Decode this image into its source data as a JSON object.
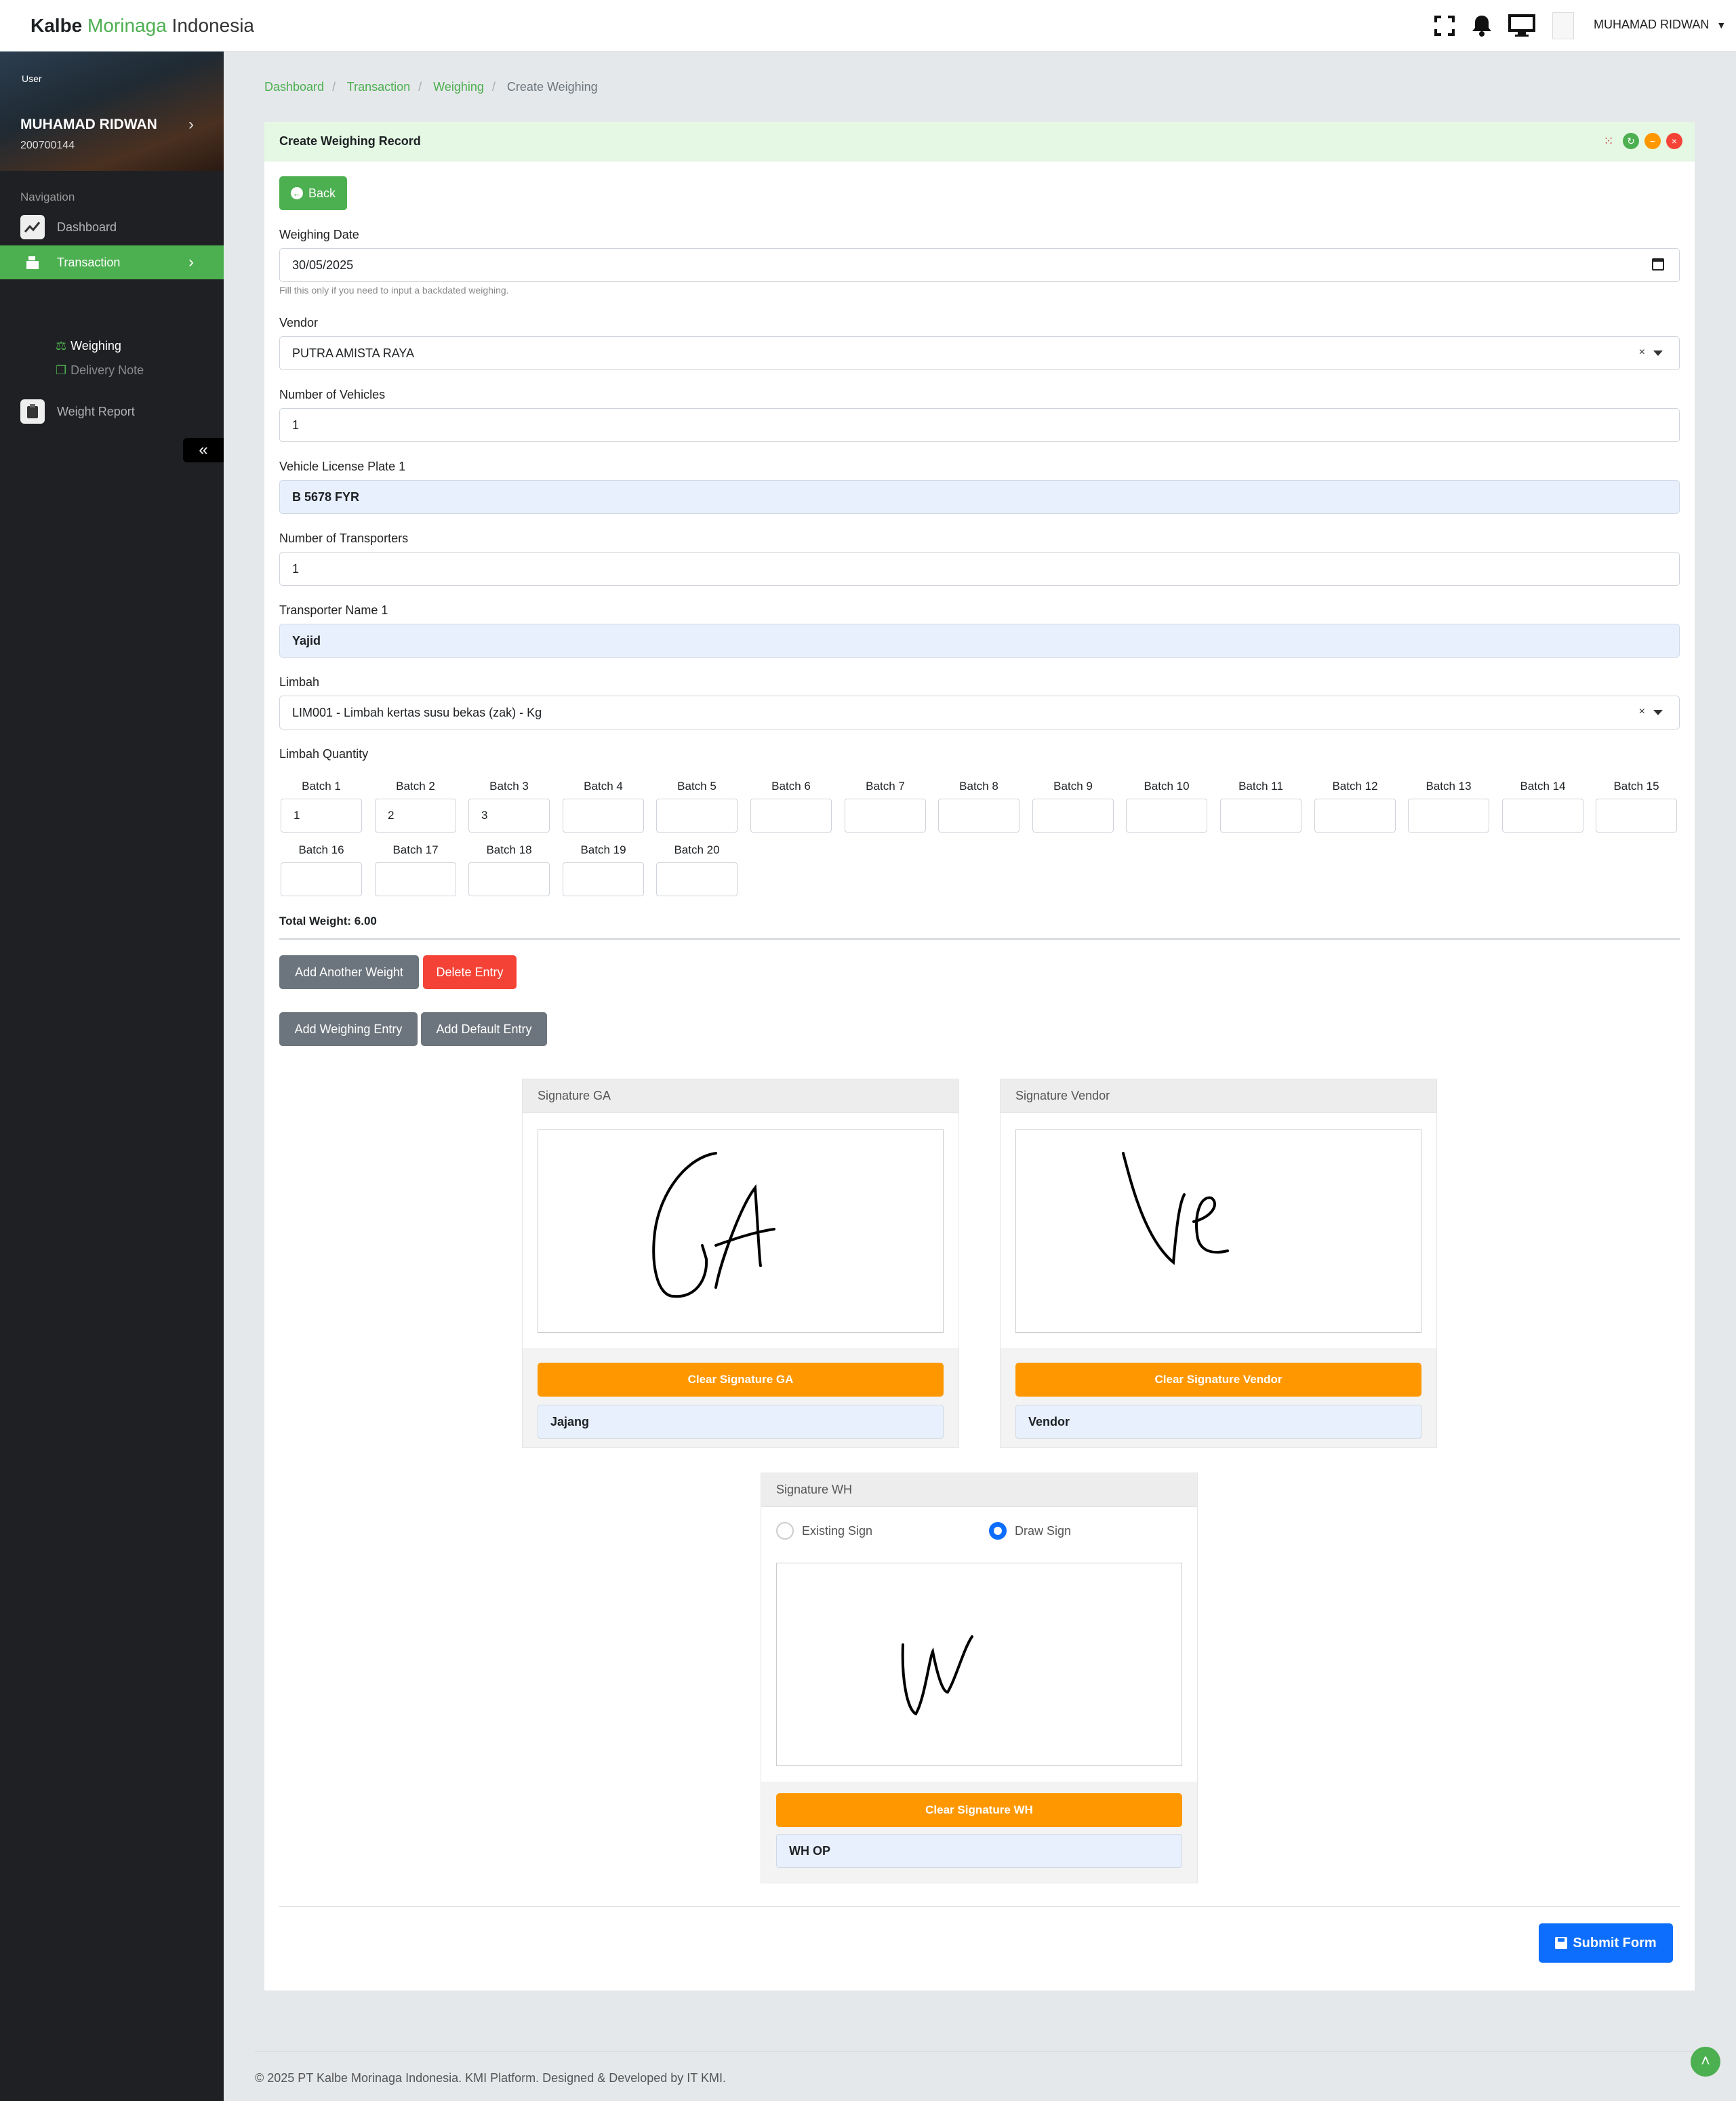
{
  "brand": {
    "part1": "Kalbe",
    "part2": "Morinaga",
    "part3": "Indonesia"
  },
  "topbar": {
    "user_name": "MUHAMAD RIDWAN",
    "icons": [
      "fullscreen-icon",
      "bell-icon",
      "monitor-icon",
      "user-avatar"
    ]
  },
  "sidebar": {
    "avatar_alt": "User",
    "user_name": "MUHAMAD RIDWAN",
    "user_id": "200700144",
    "nav_label": "Navigation",
    "items": [
      {
        "label": "Dashboard",
        "icon": "chart-icon"
      },
      {
        "label": "Transaction",
        "icon": "register-icon",
        "active": true
      },
      {
        "label": "Weight Report",
        "icon": "clipboard-icon"
      }
    ],
    "sub_items": [
      {
        "label": "Weighing",
        "icon": "scale-icon",
        "active": true
      },
      {
        "label": "Delivery Note",
        "icon": "copy-icon"
      }
    ]
  },
  "breadcrumb": [
    "Dashboard",
    "Transaction",
    "Weighing",
    "Create Weighing"
  ],
  "card": {
    "title": "Create Weighing Record"
  },
  "form": {
    "back_label": "Back",
    "weighing_date": {
      "label": "Weighing Date",
      "value": "30/05/2025",
      "help": "Fill this only if you need to input a backdated weighing."
    },
    "vendor": {
      "label": "Vendor",
      "value": "PUTRA AMISTA RAYA"
    },
    "num_vehicles": {
      "label": "Number of Vehicles",
      "value": "1"
    },
    "plate_1": {
      "label": "Vehicle License Plate 1",
      "value": "B 5678 FYR"
    },
    "num_transporters": {
      "label": "Number of Transporters",
      "value": "1"
    },
    "transporter_1": {
      "label": "Transporter Name 1",
      "value": "Yajid"
    },
    "limbah": {
      "label": "Limbah",
      "value": "LIM001 - Limbah kertas susu bekas (zak) - Kg"
    },
    "limbah_qty_label": "Limbah Quantity",
    "batches": [
      {
        "label": "Batch 1",
        "value": "1"
      },
      {
        "label": "Batch 2",
        "value": "2"
      },
      {
        "label": "Batch 3",
        "value": "3"
      },
      {
        "label": "Batch 4",
        "value": ""
      },
      {
        "label": "Batch 5",
        "value": ""
      },
      {
        "label": "Batch 6",
        "value": ""
      },
      {
        "label": "Batch 7",
        "value": ""
      },
      {
        "label": "Batch 8",
        "value": ""
      },
      {
        "label": "Batch 9",
        "value": ""
      },
      {
        "label": "Batch 10",
        "value": ""
      },
      {
        "label": "Batch 11",
        "value": ""
      },
      {
        "label": "Batch 12",
        "value": ""
      },
      {
        "label": "Batch 13",
        "value": ""
      },
      {
        "label": "Batch 14",
        "value": ""
      },
      {
        "label": "Batch 15",
        "value": ""
      },
      {
        "label": "Batch 16",
        "value": ""
      },
      {
        "label": "Batch 17",
        "value": ""
      },
      {
        "label": "Batch 18",
        "value": ""
      },
      {
        "label": "Batch 19",
        "value": ""
      },
      {
        "label": "Batch 20",
        "value": ""
      }
    ],
    "total_weight": "Total Weight: 6.00",
    "add_another_weight": "Add Another Weight",
    "delete_entry": "Delete Entry",
    "add_weighing_entry": "Add Weighing Entry",
    "add_default_entry": "Add Default Entry",
    "submit": "Submit Form"
  },
  "signatures": {
    "ga": {
      "title": "Signature GA",
      "clear": "Clear Signature GA",
      "name": "Jajang"
    },
    "vendor": {
      "title": "Signature Vendor",
      "clear": "Clear Signature Vendor",
      "name": "Vendor"
    },
    "wh": {
      "title": "Signature WH",
      "clear": "Clear Signature WH",
      "name": "WH OP",
      "option_existing": "Existing Sign",
      "option_draw": "Draw Sign",
      "selected": "Draw Sign"
    }
  },
  "footer": "© 2025 PT Kalbe Morinaga Indonesia. KMI Platform. Designed & Developed by IT KMI.",
  "colors": {
    "accent": "#4caf50",
    "sidebar": "#1f2023",
    "danger": "#f44336",
    "warning": "#ff9800",
    "primary": "#0d6efd"
  }
}
